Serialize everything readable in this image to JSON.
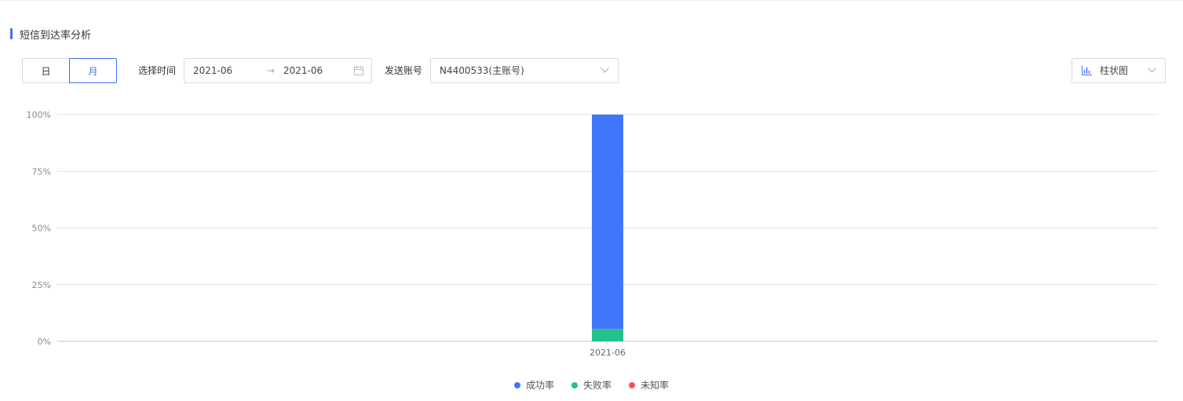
{
  "section": {
    "title": "短信到达率分析"
  },
  "granularity": {
    "options": [
      "日",
      "月"
    ],
    "selected": "月"
  },
  "time_filter": {
    "label": "选择时间",
    "start": "2021-06",
    "end": "2021-06",
    "separator": "→"
  },
  "account_filter": {
    "label": "发送账号",
    "value": "N4400533(主账号)"
  },
  "chart_type_select": {
    "value": "柱状图",
    "icon": "bar-chart-icon"
  },
  "colors": {
    "accent": "#3f73f0",
    "success": "#4176fa",
    "failure": "#23c18c",
    "unknown": "#f1545a",
    "grid": "#e0e0e0"
  },
  "chart_data": {
    "type": "bar",
    "stacked": true,
    "categories": [
      "2021-06"
    ],
    "y_ticks": [
      "0%",
      "25%",
      "50%",
      "75%",
      "100%"
    ],
    "ylim": [
      0,
      100
    ],
    "series": [
      {
        "name": "成功率",
        "values": [
          94.5
        ],
        "color": "#4176fa"
      },
      {
        "name": "失败率",
        "values": [
          5.5
        ],
        "color": "#23c18c"
      },
      {
        "name": "未知率",
        "values": [
          0
        ],
        "color": "#f1545a"
      }
    ],
    "legend_position": "bottom-center",
    "grid": true
  }
}
